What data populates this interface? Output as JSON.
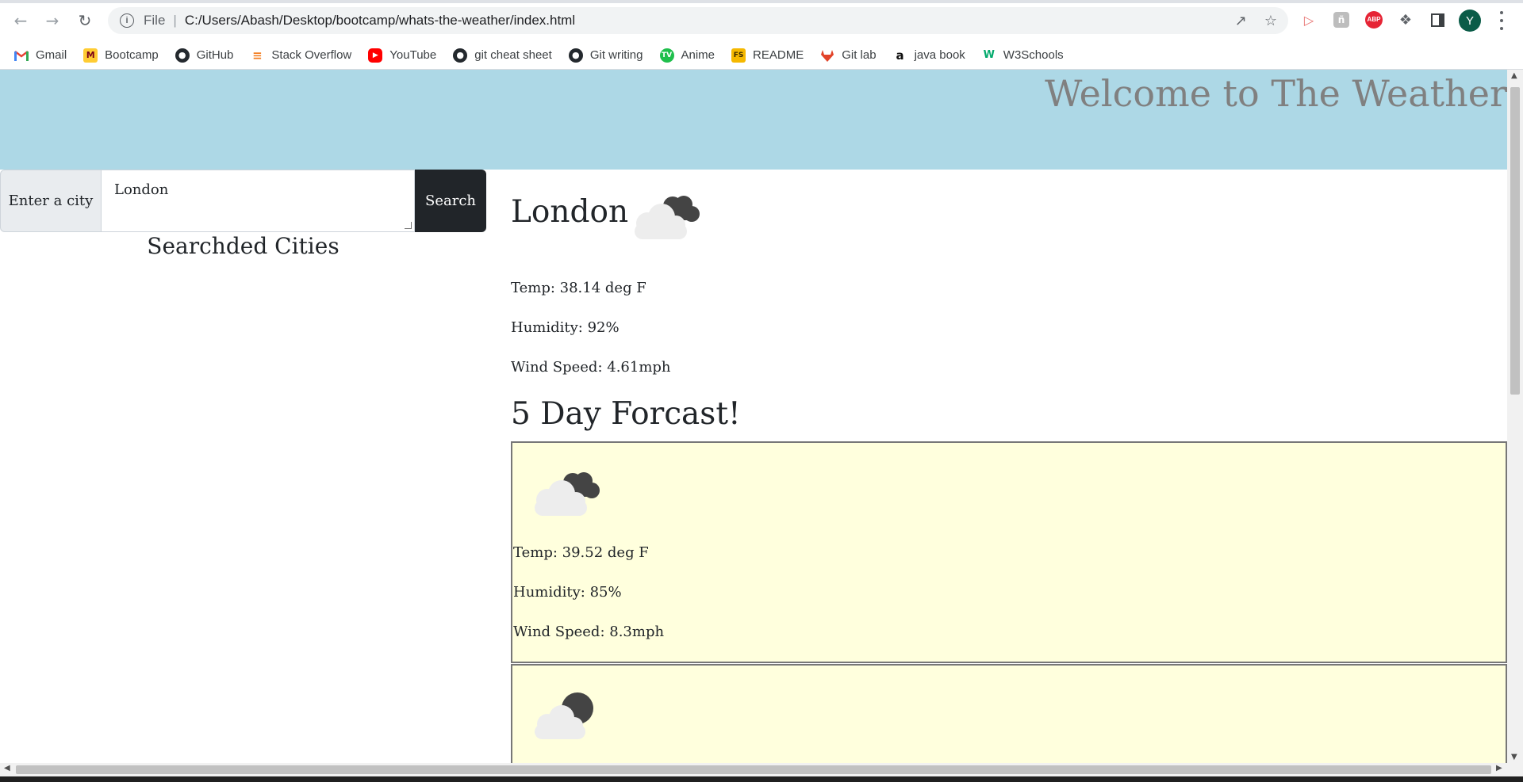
{
  "browser": {
    "address_scheme": "File",
    "address_url": "C:/Users/Abash/Desktop/bootcamp/whats-the-weather/index.html",
    "profile_initial": "Y",
    "bookmarks": [
      {
        "label": "Gmail",
        "icon": "gmail-icon"
      },
      {
        "label": "Bootcamp",
        "icon": "bootcamp-icon"
      },
      {
        "label": "GitHub",
        "icon": "github-icon"
      },
      {
        "label": "Stack Overflow",
        "icon": "stackoverflow-icon"
      },
      {
        "label": "YouTube",
        "icon": "youtube-icon"
      },
      {
        "label": "git cheat sheet",
        "icon": "github-icon"
      },
      {
        "label": "Git writing",
        "icon": "github-icon"
      },
      {
        "label": "Anime",
        "icon": "anime-icon"
      },
      {
        "label": "README",
        "icon": "readme-icon"
      },
      {
        "label": "Git lab",
        "icon": "gitlab-icon"
      },
      {
        "label": "java book",
        "icon": "amazon-icon"
      },
      {
        "label": "W3Schools",
        "icon": "w3schools-icon"
      }
    ],
    "extension_labels": {
      "readme_badge": "FS",
      "abp": "ABP",
      "n_badge": "ñ"
    }
  },
  "colors": {
    "header_bg": "#add8e6",
    "header_text": "#808080",
    "forecast_card_bg": "#ffffdd",
    "search_button_bg": "#212529"
  },
  "page": {
    "header_title": "Welcome to The Weather",
    "search": {
      "label": "Enter a city",
      "value": "London",
      "button": "Search"
    },
    "searched_cities_title": "Searchded Cities",
    "current": {
      "city": "London",
      "icon": "broken-clouds-icon",
      "temp": "Temp: 38.14 deg F",
      "humidity": "Humidity: 92%",
      "wind": "Wind Speed: 4.61mph"
    },
    "forecast_title": "5 Day Forcast!",
    "forecast": [
      {
        "icon": "broken-clouds-icon",
        "temp": "Temp: 39.52 deg F",
        "humidity": "Humidity: 85%",
        "wind": "Wind Speed: 8.3mph"
      },
      {
        "icon": "partly-cloudy-night-icon"
      }
    ]
  }
}
